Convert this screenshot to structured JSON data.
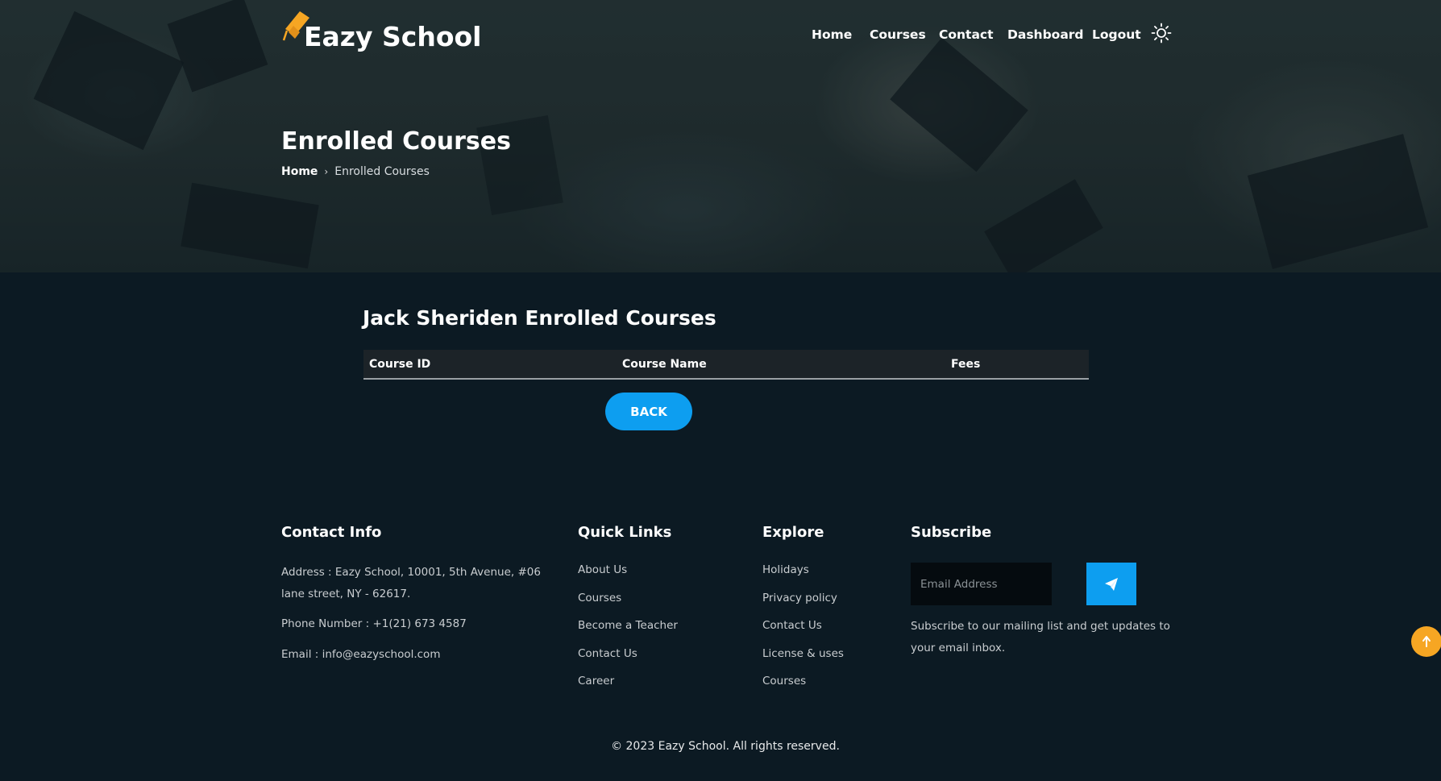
{
  "brand": {
    "name": "Eazy School",
    "accent": "#0d9ef0",
    "logo_color": "#f6a623"
  },
  "nav": {
    "items": [
      {
        "label": "Home"
      },
      {
        "label": "Courses"
      },
      {
        "label": "Contact"
      },
      {
        "label": "Dashboard"
      },
      {
        "label": "Logout"
      }
    ],
    "theme_toggle_icon": "sun-icon"
  },
  "hero": {
    "title": "Enrolled Courses",
    "breadcrumb": {
      "home": "Home",
      "current": "Enrolled Courses"
    }
  },
  "main": {
    "title": "Jack Sheriden Enrolled Courses",
    "table": {
      "columns": [
        "Course ID",
        "Course Name",
        "Fees"
      ],
      "rows": []
    },
    "back_label": "BACK"
  },
  "footer": {
    "contact": {
      "title": "Contact Info",
      "address_line1": "Address : Eazy School, 10001, 5th Avenue, #06",
      "address_line2": "lane street, NY - 62617.",
      "phone": "Phone Number : +1(21) 673 4587",
      "email": "Email : info@eazyschool.com"
    },
    "quick_links": {
      "title": "Quick Links",
      "items": [
        "About Us",
        "Courses",
        "Become a Teacher",
        "Contact Us",
        "Career"
      ]
    },
    "explore": {
      "title": "Explore",
      "items": [
        "Holidays",
        "Privacy policy",
        "Contact Us",
        "License & uses",
        "Courses"
      ]
    },
    "subscribe": {
      "title": "Subscribe",
      "placeholder": "Email Address",
      "send_icon": "paper-plane-icon",
      "text_line1": "Subscribe to our mailing list and get updates to",
      "text_line2": "your email inbox."
    },
    "copyright": "© 2023 Eazy School. All rights reserved."
  },
  "scroll_top_icon": "arrow-up-icon"
}
